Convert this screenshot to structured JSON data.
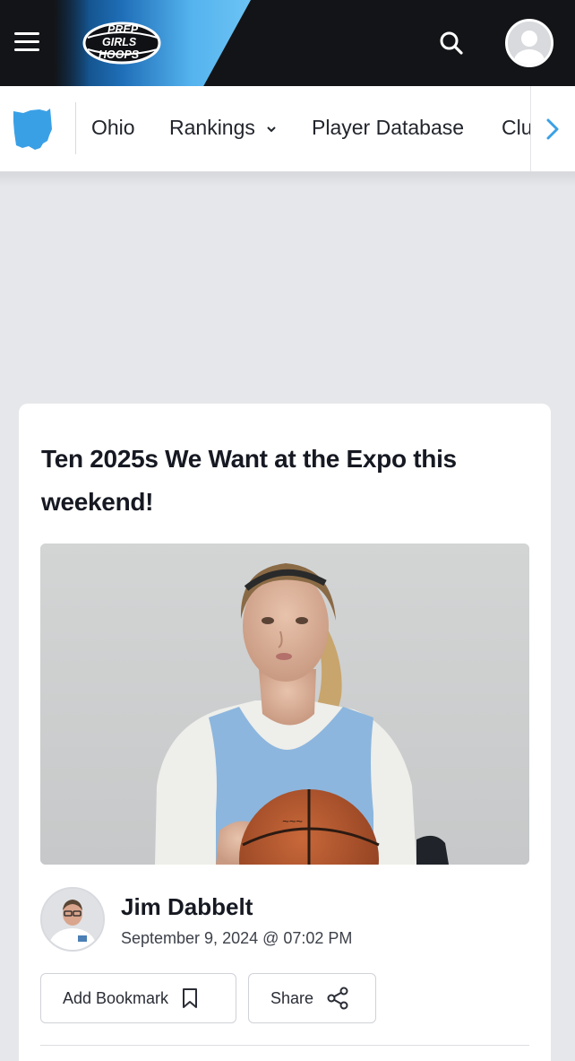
{
  "header": {
    "logo_lines": [
      "PREP",
      "GIRLS",
      "HOOPS"
    ],
    "menu_icon": "hamburger-menu-icon",
    "search_icon": "search-icon",
    "account_icon": "user-avatar-icon",
    "colors": {
      "bar": "#131417",
      "brand_blue": "#55b3ee"
    }
  },
  "subnav": {
    "state_icon": "ohio-state-icon",
    "items": [
      {
        "label": "Ohio"
      },
      {
        "label": "Rankings",
        "has_dropdown": true
      },
      {
        "label": "Player Database"
      },
      {
        "label": "Clu"
      }
    ],
    "scroll_icon": "chevron-right-icon",
    "accent": "#3aa0e6"
  },
  "article": {
    "title": "Ten 2025s We Want at the Expo this weekend!",
    "author": {
      "name": "Jim Dabbelt",
      "date": "September 9, 2024 @ 07:02 PM"
    },
    "actions": {
      "bookmark_label": "Add Bookmark",
      "bookmark_icon": "bookmark-icon",
      "share_label": "Share",
      "share_icon": "share-icon"
    }
  }
}
